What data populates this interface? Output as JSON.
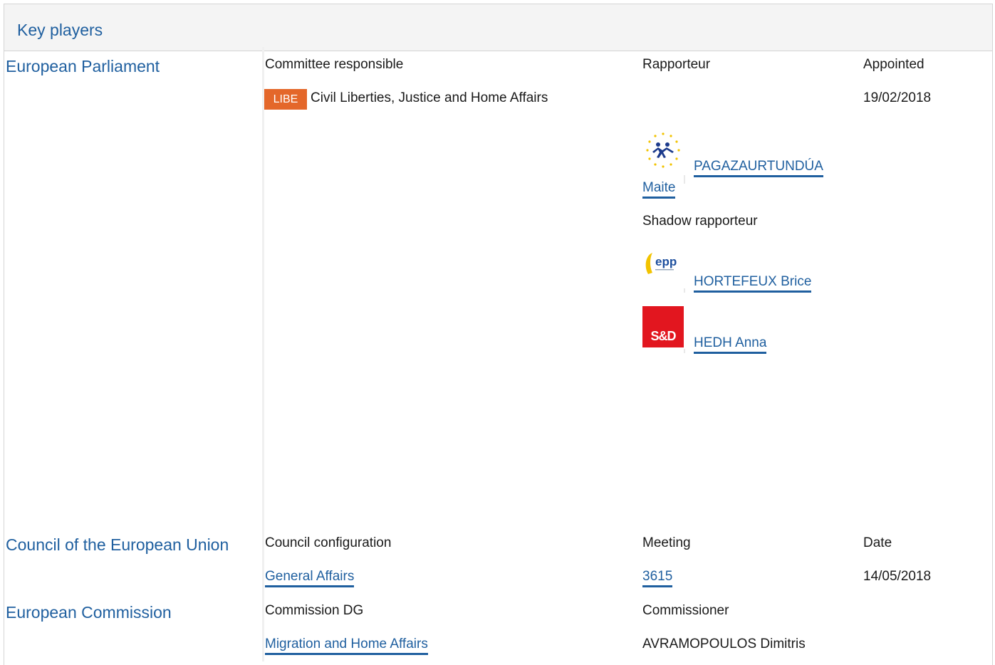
{
  "panel": {
    "title": "Key players"
  },
  "parliament": {
    "section_label": "European Parliament",
    "col_committee": "Committee responsible",
    "col_rapporteur": "Rapporteur",
    "col_appointed": "Appointed",
    "committee_badge": "LIBE",
    "committee_name": "Civil Liberties, Justice and Home Affairs",
    "appointed_date": "19/02/2018",
    "rapporteur": {
      "name_part1": "PAGAZAURTUNDÚA",
      "name_part2": "Maite",
      "group_icon": "renew-europe-logo"
    },
    "shadow_label": "Shadow rapporteur",
    "shadows": [
      {
        "name": "HORTEFEUX Brice",
        "group_icon": "epp-logo"
      },
      {
        "name": "HEDH Anna",
        "group_icon": "sd-logo",
        "logo_text": "S&D"
      }
    ]
  },
  "council": {
    "section_label": "Council of the European Union",
    "col_configuration": "Council configuration",
    "col_meeting": "Meeting",
    "col_date": "Date",
    "configuration": "General Affairs",
    "meeting": "3615",
    "date": "14/05/2018"
  },
  "commission": {
    "section_label": "European Commission",
    "col_dg": "Commission DG",
    "col_commissioner": "Commissioner",
    "dg": "Migration and Home Affairs",
    "commissioner": "AVRAMOPOULOS Dimitris"
  },
  "colors": {
    "link": "#1f5f9f",
    "badge": "#e4672a",
    "sd_red": "#e2161f"
  }
}
